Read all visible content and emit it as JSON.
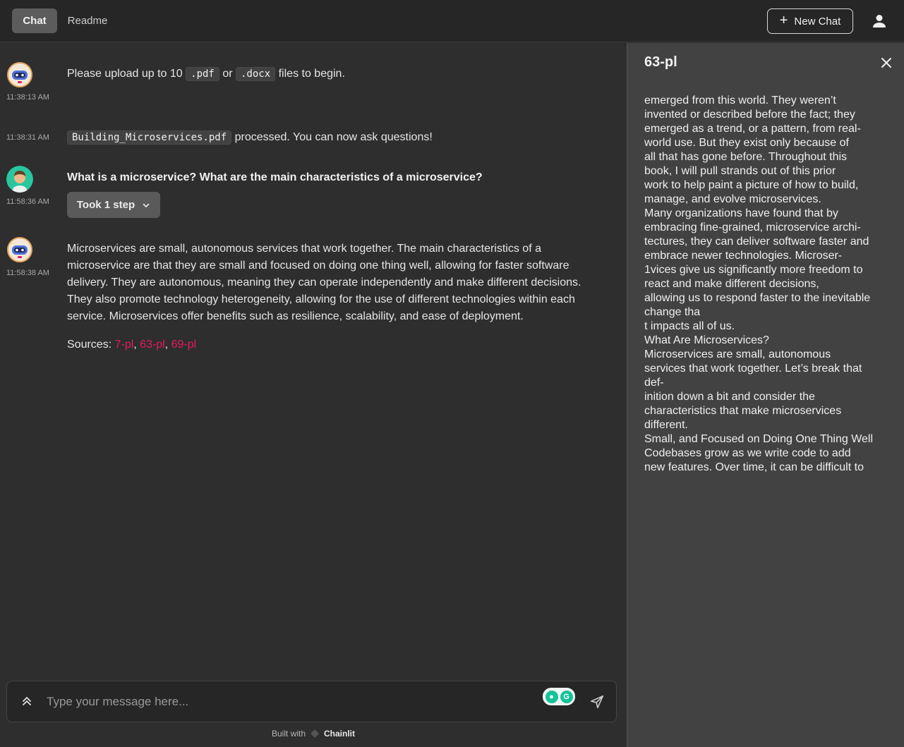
{
  "header": {
    "tabs": [
      {
        "label": "Chat"
      },
      {
        "label": "Readme"
      }
    ],
    "new_chat_label": "New Chat"
  },
  "messages": [
    {
      "time": "11:38:13 AM",
      "parts": {
        "pre": "Please upload up to 10",
        "code1": ".pdf",
        "mid": "or",
        "code2": ".docx",
        "post": "files to begin."
      }
    },
    {
      "time": "11:38:31 AM",
      "parts": {
        "code": "Building_Microservices.pdf",
        "post": "processed. You can now ask questions!"
      }
    },
    {
      "time": "11:58:36 AM",
      "text": "What is a microservice? What are the main characteristics of a microservice?",
      "step_label": "Took 1 step"
    },
    {
      "time": "11:58:38 AM",
      "lines": [
        "Microservices are small, autonomous services that work together. The main characteristics of a",
        "microservice are that they are small and focused on doing one thing well, allowing for faster software",
        "delivery. They are autonomous, meaning they can operate independently and make different decisions.",
        "They also promote technology heterogeneity, allowing for the use of different technologies within each",
        "service. Microservices offer benefits such as resilience, scalability, and ease of deployment."
      ],
      "sources_label": "Sources:",
      "sources": [
        "7-pl",
        "63-pl",
        "69-pl"
      ]
    }
  ],
  "input": {
    "placeholder": "Type your message here..."
  },
  "footer": {
    "built_with": "Built with",
    "brand": "Chainlit"
  },
  "panel": {
    "title": "63-pl",
    "lines": [
      "emerged from this world. They weren’t",
      "invented or described before the fact; they",
      "emerged as a trend, or a pattern, from real-",
      "world use. But they exist only because of",
      "all that has gone before. Throughout this",
      "book, I will pull strands out of this prior",
      "work to help paint a picture of how to build,",
      "manage, and evolve microservices.",
      "Many organizations have found that by",
      "embracing fine-grained, microservice archi-",
      "tectures, they can deliver software faster and",
      "embrace newer technologies. Microser-",
      "1vices give us significantly more freedom to",
      "react and make different decisions,",
      "allowing us to respond faster to the inevitable",
      "change tha",
      "t impacts all of us.",
      "What Are Microservices?",
      "Microservices are small, autonomous",
      "services that work together. Let’s break that",
      "def-",
      "inition down a bit and consider the",
      "characteristics that make microservices",
      "different.",
      "Small, and Focused on Doing One Thing Well",
      "Codebases grow as we write code to add",
      "new features. Over time, it can be difficult to"
    ]
  }
}
